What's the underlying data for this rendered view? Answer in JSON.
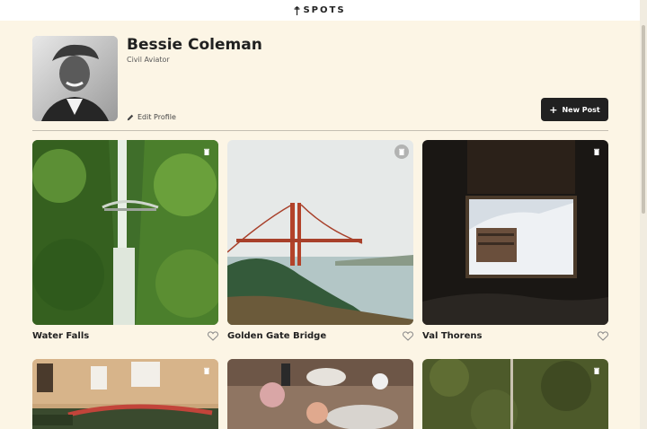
{
  "header": {
    "logo_text": "SPOTS"
  },
  "profile": {
    "name": "Bessie Coleman",
    "description": "Civil Aviator",
    "edit_label": "Edit Profile",
    "new_post_label": "New Post"
  },
  "cards": [
    {
      "title": "Water Falls",
      "liked": false
    },
    {
      "title": "Golden Gate Bridge",
      "liked": false
    },
    {
      "title": "Val Thorens",
      "liked": false
    },
    {
      "title": "",
      "liked": false
    },
    {
      "title": "",
      "liked": false
    },
    {
      "title": "",
      "liked": false
    }
  ],
  "colors": {
    "background": "#fcf5e5",
    "text": "#212121",
    "button": "#212121"
  }
}
